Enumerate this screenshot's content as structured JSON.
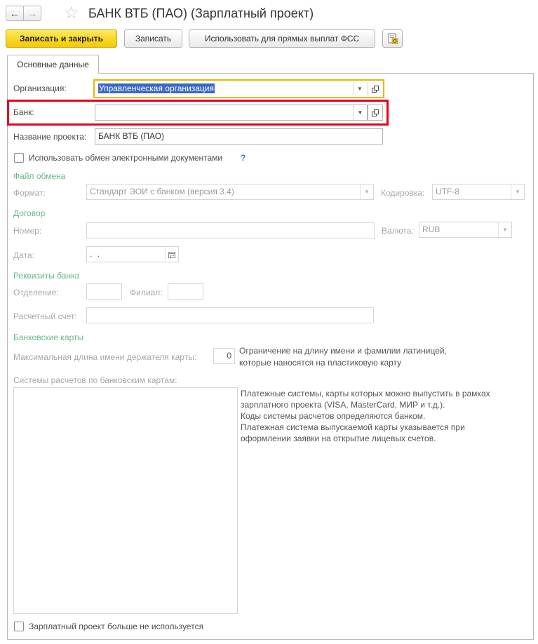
{
  "window": {
    "title": "БАНК ВТБ (ПАО) (Зарплатный проект)",
    "back_icon": "←",
    "forward_icon": "→",
    "favorite_icon": "☆"
  },
  "toolbar": {
    "save_close_label": "Записать и закрыть",
    "save_label": "Записать",
    "fss_label": "Использовать для прямых выплат ФСС",
    "report_icon": "report-icon"
  },
  "tabs": [
    {
      "label": "Основные данные"
    }
  ],
  "form": {
    "organization_label": "Организация:",
    "organization_value": "Управленческая организация",
    "bank_label": "Банк:",
    "bank_value": "",
    "project_name_label": "Название проекта:",
    "project_name_value": "БАНК ВТБ (ПАО)",
    "edo_checkbox_label": "Использовать обмен электронными документами",
    "help_mark": "?",
    "exchange_file_section": "Файл обмена",
    "format_label": "Формат:",
    "format_value": "Стандарт ЭОИ с банком (версия 3.4)",
    "encoding_label": "Кодировка:",
    "encoding_value": "UTF-8",
    "contract_section": "Договор",
    "number_label": "Номер:",
    "number_value": "",
    "currency_label": "Валюта:",
    "currency_value": "RUB",
    "date_label": "Дата:",
    "date_value": " .  .",
    "bank_details_section": "Реквизиты банка",
    "department_label": "Отделение:",
    "branch_label": "Филиал:",
    "account_label": "Расчетный счет:",
    "cards_section": "Банковские карты",
    "max_name_label": "Максимальная длина имени держателя карты:",
    "max_name_value": "0",
    "max_name_hint_line1": "Ограничение на длину имени и фамилии латиницей,",
    "max_name_hint_line2": "которые наносятся на пластиковую карту",
    "payment_systems_label": "Системы расчетов по банковским картам:",
    "payment_hint_lines": [
      "Платежные системы, карты которых можно выпустить в рамках",
      "зарплатного проекта (VISA, MasterCard, МИР и т.д.).",
      "Коды системы расчетов определяются банком.",
      "Платежная система выпускаемой карты указывается при",
      "оформлении заявки на открытие лицевых счетов."
    ],
    "not_used_checkbox_label": "Зарплатный проект больше не используется"
  },
  "colors": {
    "primary_button": "#f3c900",
    "focus_border": "#e8b800",
    "highlight_frame": "#e8001c",
    "section_header": "#64b98a",
    "selection": "#3a68c4"
  }
}
